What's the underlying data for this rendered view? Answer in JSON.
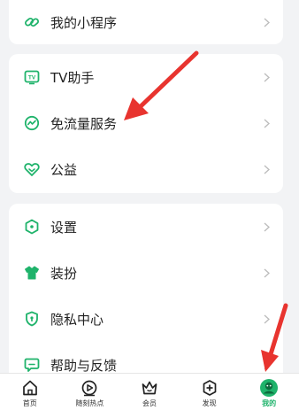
{
  "menu": {
    "mini_programs": {
      "label": "我的小程序",
      "icon": "link-icon"
    },
    "group2": [
      {
        "label": "TV助手",
        "icon": "tv-icon"
      },
      {
        "label": "免流量服务",
        "icon": "data-saver-icon"
      },
      {
        "label": "公益",
        "icon": "heart-hands-icon"
      }
    ],
    "group3": [
      {
        "label": "设置",
        "icon": "settings-hex-icon"
      },
      {
        "label": "装扮",
        "icon": "tshirt-icon"
      },
      {
        "label": "隐私中心",
        "icon": "shield-icon"
      },
      {
        "label": "帮助与反馈",
        "icon": "chat-icon"
      }
    ]
  },
  "tabbar": {
    "tabs": [
      {
        "label": "首页",
        "icon": "home-icon"
      },
      {
        "label": "随刻热点",
        "icon": "play-circle-icon"
      },
      {
        "label": "会员",
        "icon": "crown-icon"
      },
      {
        "label": "发现",
        "icon": "plus-circle-icon"
      },
      {
        "label": "我的",
        "icon": "avatar-icon",
        "active": true
      }
    ]
  },
  "colors": {
    "accent": "#1fb36b",
    "annotation_arrow": "#e8342f",
    "background": "#f2f3f5"
  }
}
